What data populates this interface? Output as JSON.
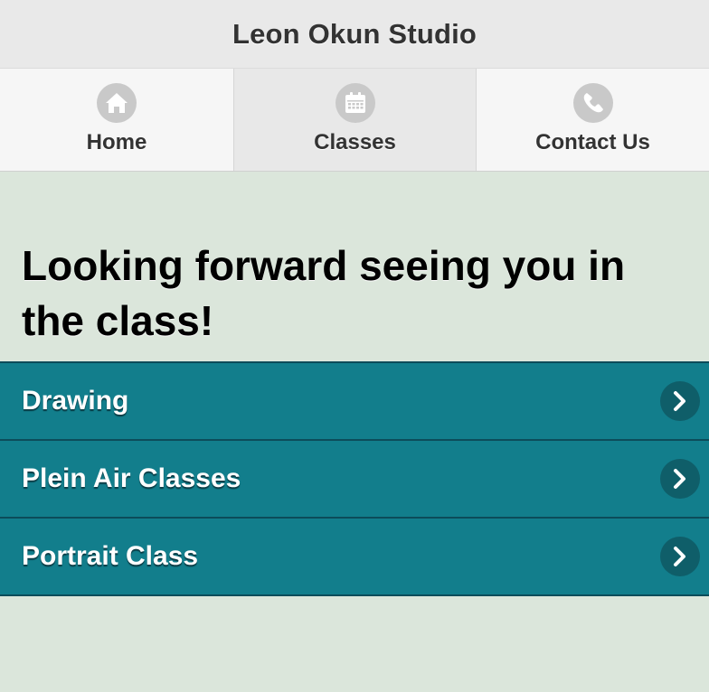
{
  "header": {
    "title": "Leon Okun Studio"
  },
  "navbar": {
    "items": [
      {
        "label": "Home",
        "icon": "home-icon"
      },
      {
        "label": "Classes",
        "icon": "calendar-icon"
      },
      {
        "label": "Contact Us",
        "icon": "phone-icon"
      }
    ],
    "active": "Classes"
  },
  "main": {
    "heading": "Looking forward seeing you in the class!",
    "classes": [
      {
        "label": "Drawing",
        "icon": "chevron-right-icon"
      },
      {
        "label": "Plein Air Classes",
        "icon": "chevron-right-icon"
      },
      {
        "label": "Portrait Class",
        "icon": "chevron-right-icon"
      }
    ]
  },
  "colors": {
    "page_background": "#dbe6db",
    "list_item_background": "#127e8c",
    "list_item_border": "#0c4c5a",
    "header_background": "#e9e9e9"
  }
}
